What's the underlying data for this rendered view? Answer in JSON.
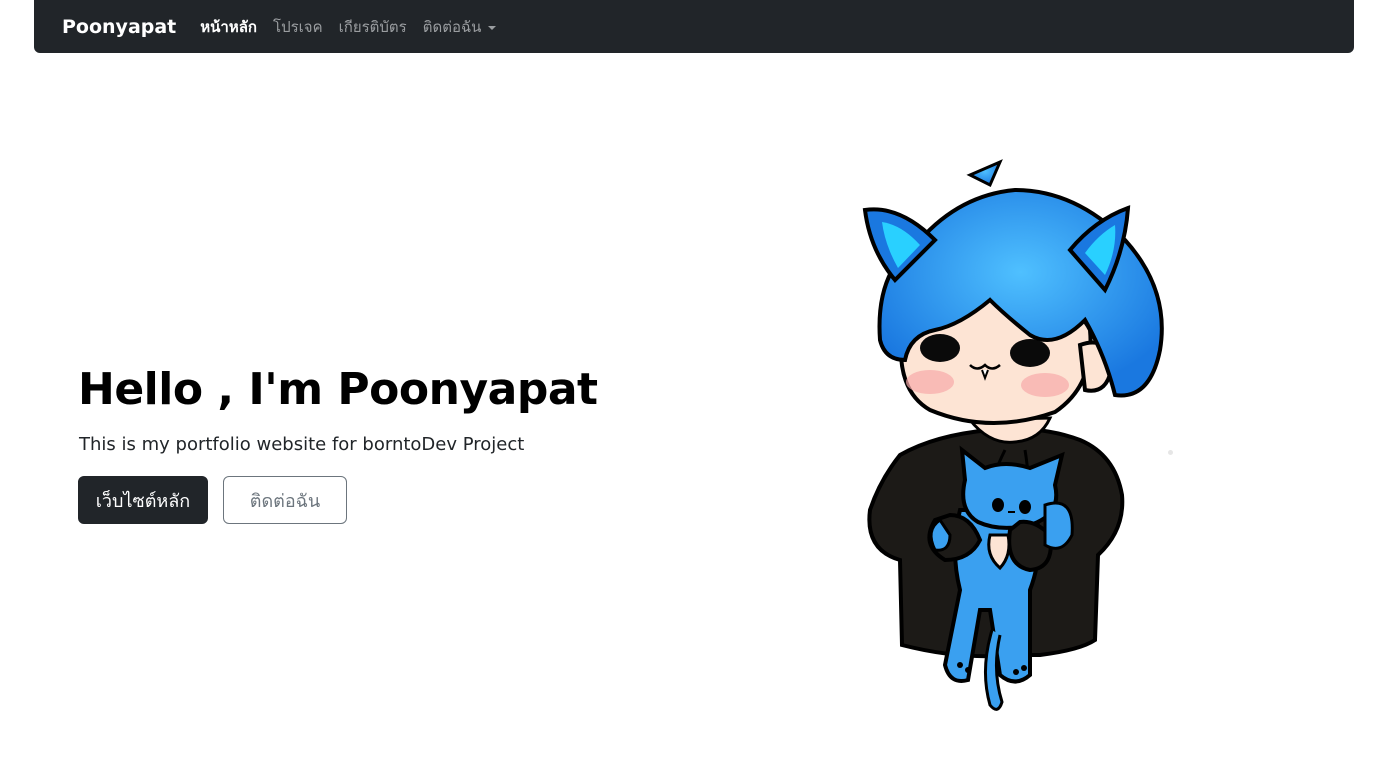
{
  "navbar": {
    "brand": "Poonyapat",
    "items": [
      {
        "label": "หน้าหลัก",
        "active": true
      },
      {
        "label": "โปรเจค",
        "active": false
      },
      {
        "label": "เกียรติบัตร",
        "active": false
      },
      {
        "label": "ติดต่อฉัน",
        "active": false,
        "dropdown": true
      }
    ]
  },
  "hero": {
    "title": "Hello , I'm Poonyapat",
    "subtitle": "This is my portfolio website for borntoDev Project",
    "primary_button": "เว็บไซต์หลัก",
    "secondary_button": "ติดต่อฉัน"
  },
  "colors": {
    "navbar_bg": "#212529",
    "hair": "#1e90ff",
    "cat": "#3aa0f0",
    "hoodie": "#1c1a17"
  }
}
